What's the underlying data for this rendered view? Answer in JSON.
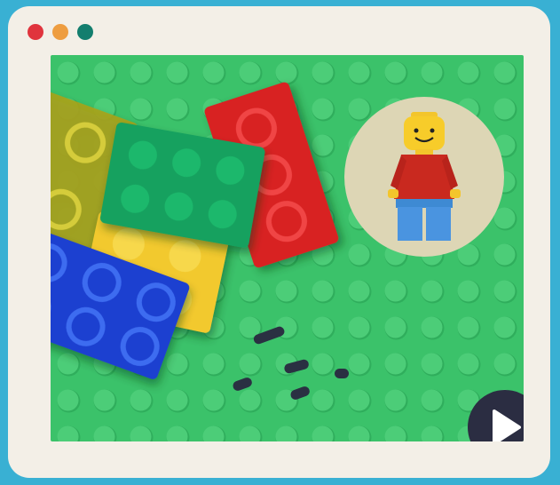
{
  "window": {
    "controls": [
      {
        "name": "close-dot",
        "color": "#e0343d"
      },
      {
        "name": "minimize-dot",
        "color": "#ee9d40"
      },
      {
        "name": "maximize-dot",
        "color": "#137e6e"
      }
    ]
  },
  "video": {
    "play_icon": "play-icon",
    "colors": {
      "baseplate": "#3bc26a",
      "red": "#d82222",
      "green": "#17a15e",
      "yellow": "#f2c92d",
      "blue": "#1b3fd0",
      "olive": "#a9a21b",
      "badge": "#ddd6b5",
      "play": "#2b2d42"
    }
  }
}
